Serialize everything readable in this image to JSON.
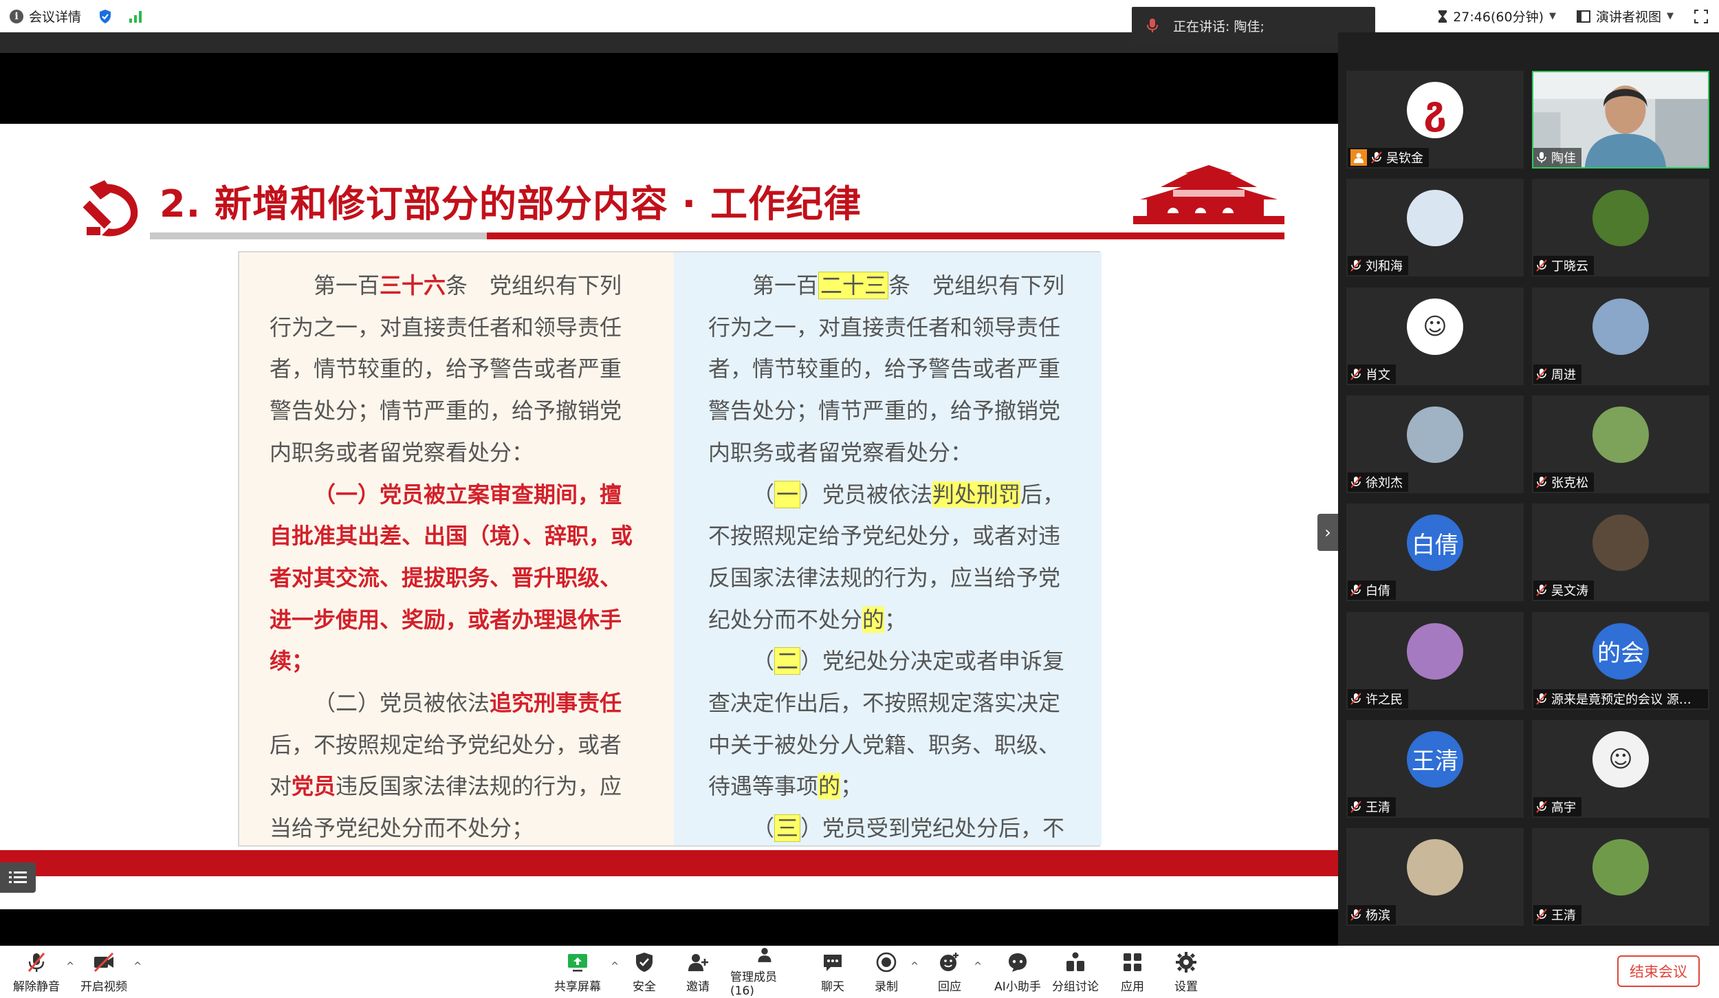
{
  "topbar": {
    "meeting_info": "会议详情",
    "speaking_prefix": "正在讲话:",
    "speaking_name": "陶佳;",
    "timer": "27:46(60分钟)",
    "view_mode": "演讲者视图"
  },
  "slide": {
    "title": "2. 新增和修订部分的部分内容 · 工作纪律",
    "left": {
      "p1_pre": "第一百",
      "p1_num": "三十六",
      "p1_post": "条　党组织有下列行为之一，对直接责任者和领导责任者，情节较重的，给予警告或者严重警告处分；情节严重的，给予撤销党内职务或者留党察看处分：",
      "p2": "（一）党员被立案审查期间，擅自批准其出差、出国（境）、辞职，或者对其交流、提拔职务、晋升职级、进一步使用、奖励，或者办理退休手续；",
      "p3_pre": "（二）党员被依法",
      "p3_red": "追究刑事责任",
      "p3_mid": "后，不按照规定给予党纪处分，或者对",
      "p3_red2": "党员",
      "p3_post": "违反国家法律法规的行为，应当给予党纪处分而不处分；"
    },
    "right": {
      "p1_pre": "第一百",
      "p1_num": "二十三",
      "p1_post": "条　党组织有下列行为之一，对直接责任者和领导责任者，情节较重的，给予警告或者严重警告处分；情节严重的，给予撤销党内职务或者留党察看处分：",
      "p2_open": "（",
      "p2_num": "一",
      "p2_mid": "）党员被依法",
      "p2_hl": "判处刑罚",
      "p2_post": "后，不按照规定给予党纪处分，或者对违反国家法律法规的行为，应当给予党纪处分而不处分",
      "p2_de": "的",
      "p2_end": "；",
      "p3_open": "（",
      "p3_num": "二",
      "p3_post": "）党纪处分决定或者申诉复查决定作出后，不按照规定落实决定中关于被处分人党籍、职务、职级、待遇等事项",
      "p3_de": "的",
      "p3_end": "；",
      "p4_open": "（",
      "p4_num": "三",
      "p4_post": "）党员受到党纪处分后，不"
    }
  },
  "participants": [
    {
      "name": "吴钦金",
      "avatar_text": "",
      "host": true
    },
    {
      "name": "陶佳",
      "avatar_text": "",
      "active": true
    },
    {
      "name": "刘和海",
      "avatar_text": ""
    },
    {
      "name": "丁晓云",
      "avatar_text": ""
    },
    {
      "name": "肖文",
      "avatar_text": ""
    },
    {
      "name": "周进",
      "avatar_text": ""
    },
    {
      "name": "徐刘杰",
      "avatar_text": ""
    },
    {
      "name": "张克松",
      "avatar_text": ""
    },
    {
      "name": "白倩",
      "avatar_text": "白倩"
    },
    {
      "name": "吴文涛",
      "avatar_text": ""
    },
    {
      "name": "许之民",
      "avatar_text": ""
    },
    {
      "name": "源来是竟预定的会议 源来...",
      "avatar_text": "的会"
    },
    {
      "name": "王清",
      "avatar_text": "王清"
    },
    {
      "name": "高宇",
      "avatar_text": ""
    },
    {
      "name": "杨滨",
      "avatar_text": ""
    },
    {
      "name": "王清",
      "avatar_text": ""
    }
  ],
  "toolbar": {
    "unmute": "解除静音",
    "start_video": "开启视频",
    "share_screen": "共享屏幕",
    "security": "安全",
    "invite": "邀请",
    "manage_members": "管理成员(16)",
    "chat": "聊天",
    "record": "录制",
    "reactions": "回应",
    "ai_assistant": "AI小助手",
    "breakout": "分组讨论",
    "apps": "应用",
    "settings": "设置",
    "end_meeting": "结束会议"
  },
  "colors": {
    "slide_red": "#c2101a",
    "active_green": "#2fca5a",
    "highlight": "#ffff66",
    "end_red": "#e0453a"
  }
}
